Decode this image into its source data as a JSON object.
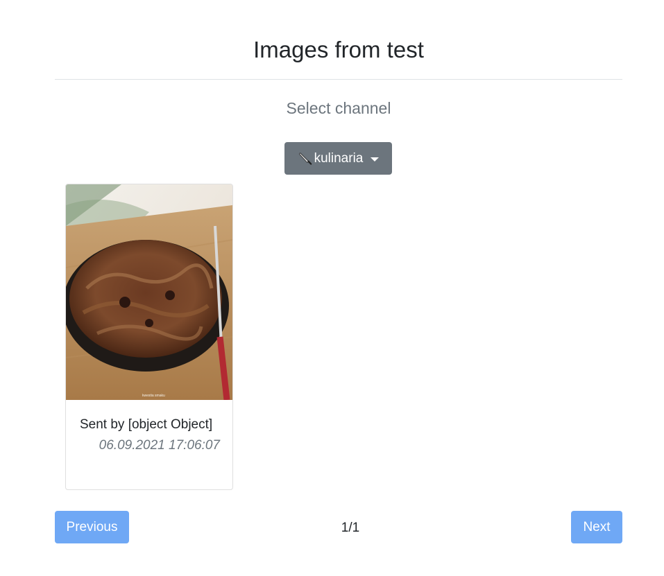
{
  "header": {
    "title": "Images from test",
    "subtitle": "Select channel"
  },
  "channel_dropdown": {
    "selected_label": "kulinaria",
    "selected_icon": "kitchen-knife-icon",
    "caret_icon": "caret-down-icon",
    "color": "#6c757d"
  },
  "cards": [
    {
      "sender_text": "Sent by [object Object]",
      "date": "06.09.2021 17:06:07",
      "image": "food-photo-bigos-in-bowl",
      "watermark": "kwestia smaku"
    }
  ],
  "pagination": {
    "previous_label": "Previous",
    "next_label": "Next",
    "page_indicator": "1/1",
    "button_color": "#6fa8f5"
  }
}
